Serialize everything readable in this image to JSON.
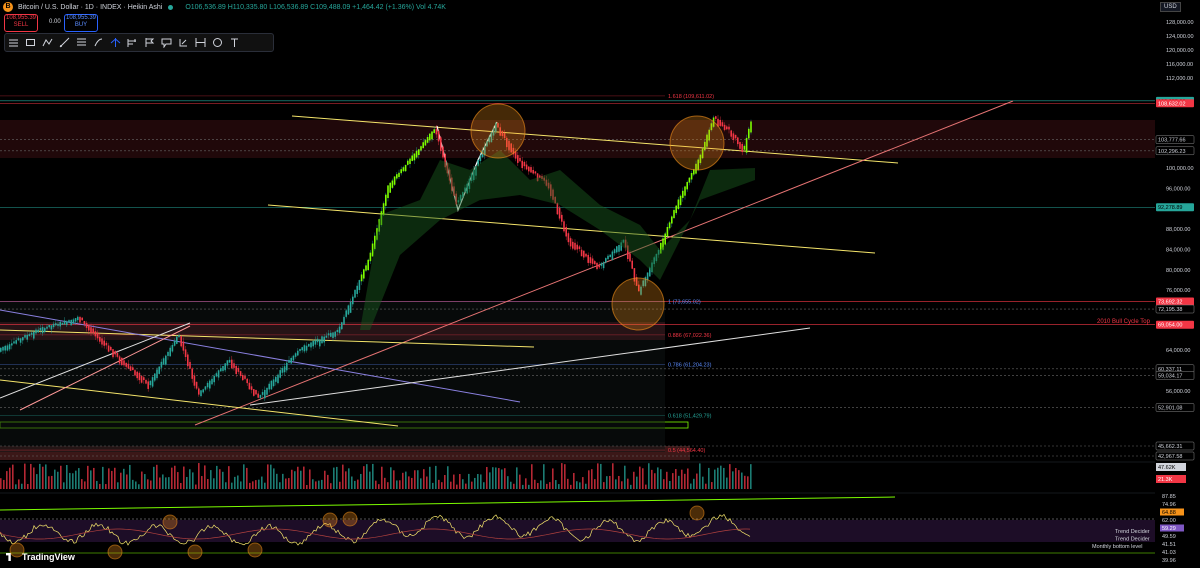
{
  "header": {
    "symbol_title": "Bitcoin / U.S. Dollar · 1D · INDEX · Heikin Ashi",
    "ohlc": "O106,536.89 H110,335.80 L106,536.89 C109,488.09 +1,464.42 (+1.36%) Vol 4.74K",
    "currency": "USD",
    "logo_letter": "B"
  },
  "trade": {
    "sell_price": "108,955.39",
    "sell_label": "SELL",
    "buy_price": "108,955.39",
    "buy_label": "BUY",
    "spread": "0.00"
  },
  "toolbar": {
    "icons": [
      "hamburger-icon",
      "rectangle-icon",
      "path-icon",
      "trendline-icon",
      "fib-icon",
      "brush-icon",
      "pitchfork-icon",
      "forecast-icon",
      "flag-icon",
      "callout-icon",
      "price-range-icon",
      "date-range-icon",
      "cycle-icon",
      "text-icon"
    ]
  },
  "chart_data": {
    "type": "candlestick",
    "price_axis": {
      "ticks": [
        "128,000.00",
        "124,000.00",
        "120,000.00",
        "116,000.00",
        "112,000.00",
        "100,000.00",
        "96,000.00",
        "88,000.00",
        "84,000.00",
        "80,000.00",
        "76,000.00",
        "64,000.00",
        "56,000.00"
      ],
      "tick_values": [
        128000,
        124000,
        120000,
        116000,
        112000,
        100000,
        96000,
        88000,
        84000,
        80000,
        76000,
        64000,
        56000
      ]
    },
    "price_tags": [
      {
        "text": "108,955.39",
        "value": 108955.39,
        "bg": "#26a69a",
        "fg": "#000000"
      },
      {
        "text": "108,632.02",
        "value": 108632.02,
        "bg": "#f23645",
        "fg": "#ffffff"
      },
      {
        "text": "103,777.66",
        "value": 103777.66,
        "bg": "#000000",
        "fg": "#d1d4dc",
        "border": true
      },
      {
        "text": "102,296.23",
        "value": 102296.23,
        "bg": "#000000",
        "fg": "#d1d4dc",
        "border": true
      },
      {
        "text": "92,278.89",
        "value": 92278.89,
        "bg": "#26a69a",
        "fg": "#000000"
      },
      {
        "text": "73,692.32",
        "value": 73692.32,
        "bg": "#f23645",
        "fg": "#ffffff"
      },
      {
        "text": "72,195.38",
        "value": 72195.38,
        "bg": "#000000",
        "fg": "#d1d4dc",
        "border": true
      },
      {
        "text": "69,054.00",
        "value": 69054.0,
        "bg": "#f23645",
        "fg": "#ffffff"
      },
      {
        "text": "60,337.11",
        "value": 60337.11,
        "bg": "#000000",
        "fg": "#d1d4dc",
        "border": true
      },
      {
        "text": "59,034.17",
        "value": 59034.17,
        "bg": "#000000",
        "fg": "#d1d4dc",
        "border": true
      },
      {
        "text": "52,901.08",
        "value": 52901.08,
        "bg": "#000000",
        "fg": "#d1d4dc",
        "border": true
      },
      {
        "text": "45,662.31",
        "value": 45662.31,
        "bg": "#000000",
        "fg": "#d1d4dc",
        "border": true
      },
      {
        "text": "42,967.58",
        "value": 42967.58,
        "bg": "#000000",
        "fg": "#d1d4dc",
        "border": true
      }
    ],
    "fib_levels": [
      {
        "text": "1.618 (109,611.02)",
        "value": 109611.02,
        "color": "#f23645"
      },
      {
        "text": "1 (73,655.02)",
        "value": 73655.02,
        "color": "#5b8cff"
      },
      {
        "text": "0.886 (67,022.36)",
        "value": 67022.36,
        "color": "#f23645"
      },
      {
        "text": "0.786 (61,204.23)",
        "value": 61204.23,
        "color": "#5b8cff"
      },
      {
        "text": "0.618 (51,429.79)",
        "value": 51429.79,
        "color": "#26a69a"
      },
      {
        "text": "0.5 (44,564.40)",
        "value": 44564.4,
        "color": "#f23645"
      }
    ],
    "annotation": "2010 Bull Cycle Top",
    "volume_tags": [
      {
        "text": "47.62K",
        "bg": "#d1d4dc",
        "fg": "#000000"
      },
      {
        "text": "21.3K",
        "bg": "#f23645",
        "fg": "#ffffff"
      }
    ],
    "oscillator": {
      "tags": [
        {
          "text": "87.85",
          "bg": "#000000",
          "fg": "#d1d4dc"
        },
        {
          "text": "74.96",
          "bg": "#000000",
          "fg": "#d1d4dc"
        },
        {
          "text": "64.88",
          "bg": "#f7931a",
          "fg": "#000000"
        },
        {
          "text": "62.00",
          "bg": "#000000",
          "fg": "#d1d4dc"
        },
        {
          "text": "59.29",
          "bg": "#7e57c2",
          "fg": "#ffffff"
        },
        {
          "text": "49.59",
          "bg": "#000000",
          "fg": "#d1d4dc"
        },
        {
          "text": "41.51",
          "bg": "#000000",
          "fg": "#d1d4dc"
        },
        {
          "text": "41.03",
          "bg": "#000000",
          "fg": "#d1d4dc"
        },
        {
          "text": "39.96",
          "bg": "#000000",
          "fg": "#d1d4dc"
        }
      ],
      "labels": [
        "Trend Decider",
        "Trend Decider",
        "Monthly bottom level"
      ]
    },
    "colors": {
      "up": "#26a69a",
      "down": "#f23645",
      "bright_up": "#7CFC00",
      "yellow": "#f5e56b",
      "salmon": "#e57373",
      "orange": "#f7931a"
    }
  },
  "footer": {
    "brand": "TradingView"
  }
}
